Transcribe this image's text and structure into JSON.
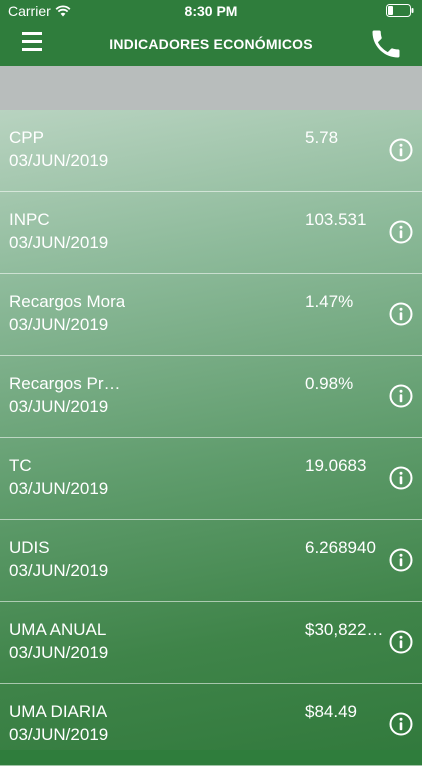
{
  "status_bar": {
    "carrier": "Carrier",
    "time": "8:30 PM"
  },
  "header": {
    "title": "INDICADORES ECONÓMICOS"
  },
  "colors": {
    "brand_green": "#2f7d3c",
    "subheader_gray": "#b8bdbc"
  },
  "indicators": [
    {
      "name": "CPP",
      "date": "03/JUN/2019",
      "value": "5.78"
    },
    {
      "name": "INPC",
      "date": "03/JUN/2019",
      "value": "103.531"
    },
    {
      "name": "Recargos Mora",
      "date": "03/JUN/2019",
      "value": "1.47%"
    },
    {
      "name": "Recargos Pr…",
      "date": "03/JUN/2019",
      "value": "0.98%"
    },
    {
      "name": "TC",
      "date": "03/JUN/2019",
      "value": "19.0683"
    },
    {
      "name": "UDIS",
      "date": "03/JUN/2019",
      "value": "6.268940"
    },
    {
      "name": "UMA ANUAL",
      "date": "03/JUN/2019",
      "value": "$30,822…"
    },
    {
      "name": "UMA DIARIA",
      "date": "03/JUN/2019",
      "value": "$84.49"
    }
  ]
}
